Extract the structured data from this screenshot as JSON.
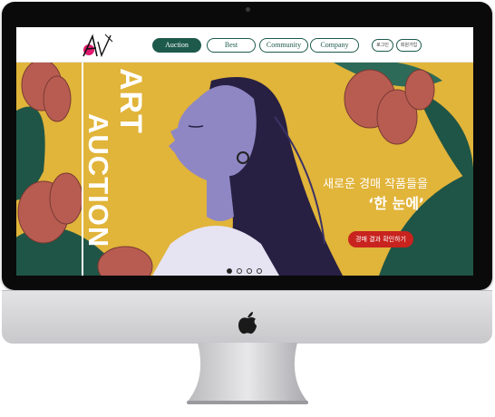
{
  "device": {
    "name": "iMac",
    "logo_icon": "apple-logo-icon"
  },
  "nav": {
    "logo_text": "Ar",
    "items": [
      {
        "label": "Auction",
        "active": true
      },
      {
        "label": "Best",
        "active": false
      },
      {
        "label": "Community",
        "active": false
      },
      {
        "label": "Company",
        "active": false
      }
    ],
    "login": "로그인",
    "signup": "회원가입",
    "accent": "#1d5a4c"
  },
  "hero": {
    "title_art": "ART",
    "title_auction": "AUCTION",
    "headline_line1": "새로운 경매 작품들을",
    "headline_line2": "‘한 눈에’",
    "cta_label": "경매 결과 확인하기",
    "cta_color": "#c8231e",
    "background": "#e1b43a",
    "slide_count": 4,
    "active_slide": 1
  }
}
